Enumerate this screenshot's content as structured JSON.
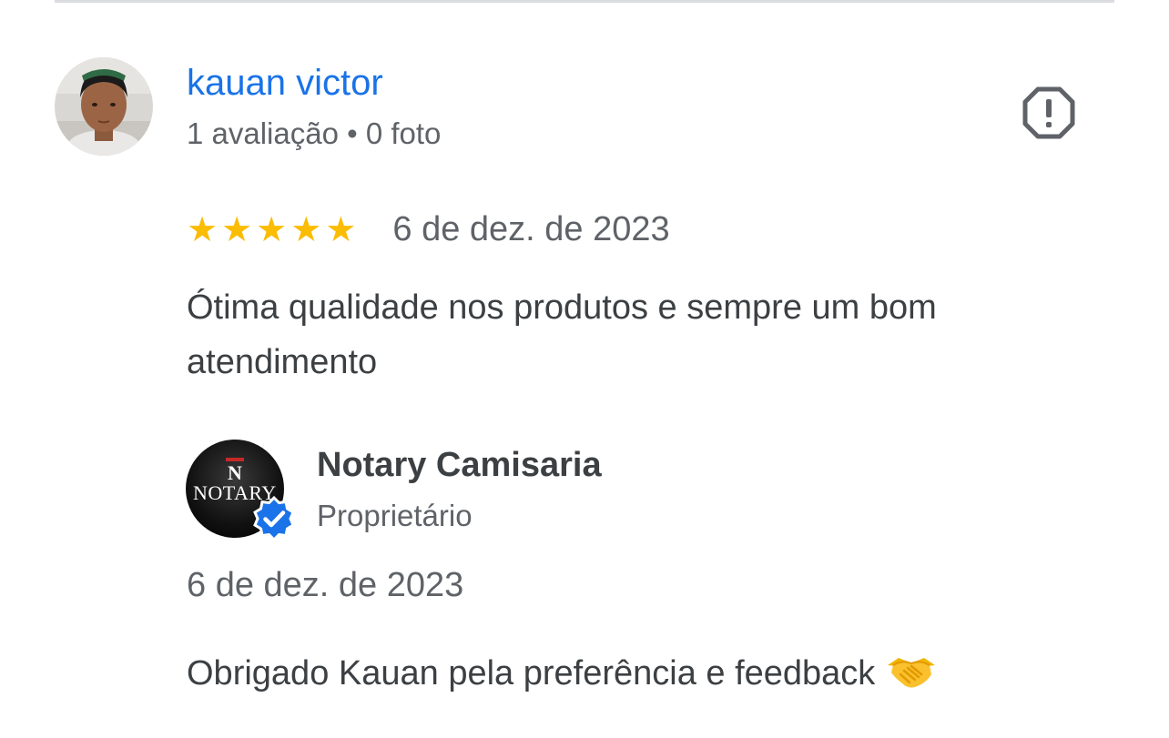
{
  "review": {
    "reviewer_name": "kauan victor",
    "reviewer_meta": "1 avaliação • 0 foto",
    "rating": 5,
    "rating_max": 5,
    "date": "6 de dez. de 2023",
    "text": "Ótima qualidade nos produtos e sempre um bom atendimento"
  },
  "owner_reply": {
    "business_name": "Notary Camisaria",
    "role": "Proprietário",
    "logo_text": "NOTARY",
    "logo_mark": "N",
    "date": "6 de dez. de 2023",
    "text": "Obrigado Kauan pela preferência e feedback"
  },
  "icons": {
    "report": "report-icon",
    "star": "star-icon",
    "verified": "verified-badge-icon",
    "handshake": "handshake-emoji-icon"
  },
  "colors": {
    "link": "#1a73e8",
    "star": "#fbbc04",
    "verified": "#1a73e8",
    "primary_text": "#3c4043",
    "secondary_text": "#5f6368",
    "divider": "#dadce0"
  }
}
